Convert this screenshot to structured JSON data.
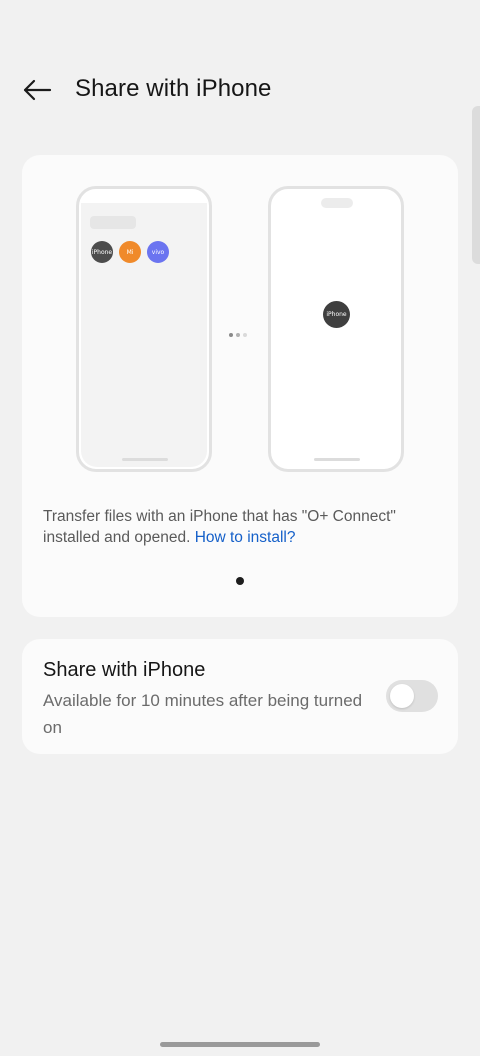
{
  "header": {
    "title": "Share with iPhone",
    "back_icon": "arrow-left-icon"
  },
  "illustration": {
    "left_phone": {
      "devices": [
        {
          "label": "iPhone",
          "color": "#4c4c4c"
        },
        {
          "label": "Mi",
          "color": "#f08a2a"
        },
        {
          "label": "vivo",
          "color": "#6b74f0"
        }
      ]
    },
    "right_phone": {
      "device_label": "iPhone"
    }
  },
  "info": {
    "description": "Transfer files with an iPhone that has \"O+ Connect\" installed and opened.",
    "link_text": "How to install?",
    "link_color": "#1560c9"
  },
  "pager": {
    "current": 1,
    "total": 1
  },
  "setting": {
    "title": "Share with iPhone",
    "subtitle": "Available for 10 minutes after being turned on",
    "toggle_on": false
  }
}
